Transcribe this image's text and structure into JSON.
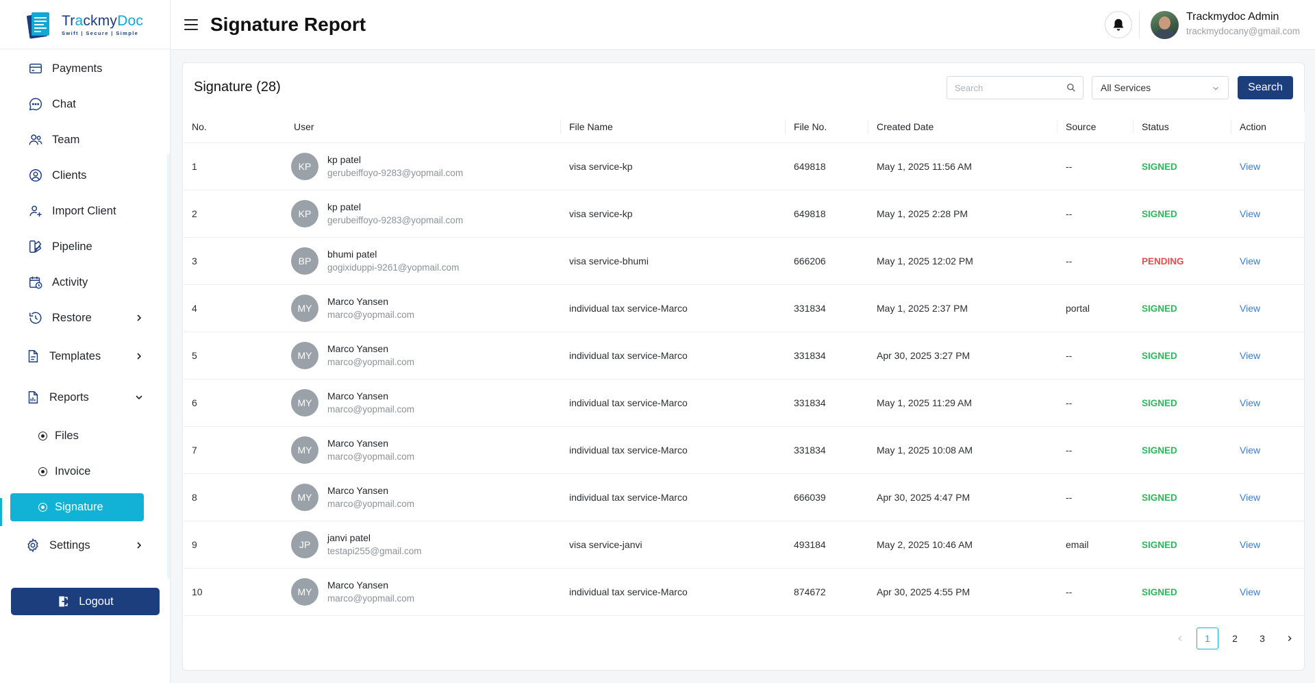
{
  "app": {
    "logo_name_part1": "Tr",
    "logo_name_accent": "a",
    "logo_name_part2": "ckmy",
    "logo_name_part3": "Doc",
    "tagline": "Swift | Secure | Simple"
  },
  "sidebar": {
    "items": [
      {
        "label": "Payments",
        "icon": "credit-card-icon"
      },
      {
        "label": "Chat",
        "icon": "chat-bubble-icon"
      },
      {
        "label": "Team",
        "icon": "users-icon"
      },
      {
        "label": "Clients",
        "icon": "user-circle-icon"
      },
      {
        "label": "Import Client",
        "icon": "user-plus-icon"
      },
      {
        "label": "Pipeline",
        "icon": "pipeline-icon"
      },
      {
        "label": "Activity",
        "icon": "calendar-clock-icon"
      },
      {
        "label": "Restore",
        "icon": "history-icon"
      },
      {
        "label": "Templates",
        "icon": "document-icon"
      },
      {
        "label": "Reports",
        "icon": "report-icon"
      },
      {
        "label": "Settings",
        "icon": "gear-icon"
      }
    ],
    "report_subitems": [
      {
        "label": "Files"
      },
      {
        "label": "Invoice"
      },
      {
        "label": "Signature"
      }
    ],
    "logout_label": "Logout"
  },
  "header": {
    "title": "Signature Report",
    "user_name": "Trackmydoc Admin",
    "user_email": "trackmydocany@gmail.com"
  },
  "card": {
    "title": "Signature (28)",
    "search_placeholder": "Search",
    "service_filter": "All Services",
    "search_button": "Search"
  },
  "table": {
    "columns": [
      "No.",
      "User",
      "File Name",
      "File No.",
      "Created Date",
      "Source",
      "Status",
      "Action"
    ],
    "rows": [
      {
        "no": "1",
        "initials": "KP",
        "name": "kp patel",
        "email": "gerubeiffoyo-9283@yopmail.com",
        "file": "visa service-kp",
        "file_no": "649818",
        "date": "May 1, 2025 11:56 AM",
        "source": "--",
        "status": "SIGNED",
        "action": "View"
      },
      {
        "no": "2",
        "initials": "KP",
        "name": "kp patel",
        "email": "gerubeiffoyo-9283@yopmail.com",
        "file": "visa service-kp",
        "file_no": "649818",
        "date": "May 1, 2025 2:28 PM",
        "source": "--",
        "status": "SIGNED",
        "action": "View"
      },
      {
        "no": "3",
        "initials": "BP",
        "name": "bhumi patel",
        "email": "gogixiduppi-9261@yopmail.com",
        "file": "visa service-bhumi",
        "file_no": "666206",
        "date": "May 1, 2025 12:02 PM",
        "source": "--",
        "status": "PENDING",
        "action": "View"
      },
      {
        "no": "4",
        "initials": "MY",
        "name": "Marco Yansen",
        "email": "marco@yopmail.com",
        "file": "individual tax service-Marco",
        "file_no": "331834",
        "date": "May 1, 2025 2:37 PM",
        "source": "portal",
        "status": "SIGNED",
        "action": "View"
      },
      {
        "no": "5",
        "initials": "MY",
        "name": "Marco Yansen",
        "email": "marco@yopmail.com",
        "file": "individual tax service-Marco",
        "file_no": "331834",
        "date": "Apr 30, 2025 3:27 PM",
        "source": "--",
        "status": "SIGNED",
        "action": "View"
      },
      {
        "no": "6",
        "initials": "MY",
        "name": "Marco Yansen",
        "email": "marco@yopmail.com",
        "file": "individual tax service-Marco",
        "file_no": "331834",
        "date": "May 1, 2025 11:29 AM",
        "source": "--",
        "status": "SIGNED",
        "action": "View"
      },
      {
        "no": "7",
        "initials": "MY",
        "name": "Marco Yansen",
        "email": "marco@yopmail.com",
        "file": "individual tax service-Marco",
        "file_no": "331834",
        "date": "May 1, 2025 10:08 AM",
        "source": "--",
        "status": "SIGNED",
        "action": "View"
      },
      {
        "no": "8",
        "initials": "MY",
        "name": "Marco Yansen",
        "email": "marco@yopmail.com",
        "file": "individual tax service-Marco",
        "file_no": "666039",
        "date": "Apr 30, 2025 4:47 PM",
        "source": "--",
        "status": "SIGNED",
        "action": "View"
      },
      {
        "no": "9",
        "initials": "JP",
        "name": "janvi patel",
        "email": "testapi255@gmail.com",
        "file": "visa service-janvi",
        "file_no": "493184",
        "date": "May 2, 2025 10:46 AM",
        "source": "email",
        "status": "SIGNED",
        "action": "View"
      },
      {
        "no": "10",
        "initials": "MY",
        "name": "Marco Yansen",
        "email": "marco@yopmail.com",
        "file": "individual tax service-Marco",
        "file_no": "874672",
        "date": "Apr 30, 2025 4:55 PM",
        "source": "--",
        "status": "SIGNED",
        "action": "View"
      }
    ]
  },
  "pagination": {
    "pages": [
      "1",
      "2",
      "3"
    ],
    "current": "1"
  },
  "colors": {
    "brand_navy": "#1d3e7d",
    "accent_cyan": "#12b2d6",
    "signed_green": "#2eb85c",
    "pending_red": "#e84b4b",
    "link_blue": "#3a7bd5"
  }
}
